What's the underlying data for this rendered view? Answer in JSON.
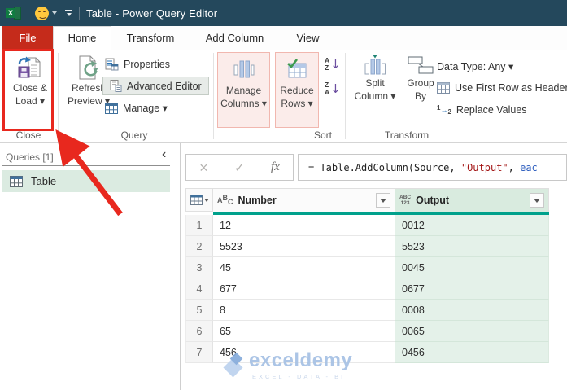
{
  "colors": {
    "titlebar": "#24485C",
    "file_tab_red": "#C52B1B",
    "accent_teal": "#00A18C",
    "selection_green": "#E4F1E9",
    "annotation_red": "#E8281E",
    "pink_highlight": "#FBECEA"
  },
  "titlebar": {
    "title": "Table - Power Query Editor",
    "excel_logo_letter": "X"
  },
  "tabs": {
    "file": "File",
    "home": "Home",
    "transform": "Transform",
    "add_column": "Add Column",
    "view": "View"
  },
  "ribbon": {
    "close_load": {
      "line1": "Close &",
      "line2": "Load ▾"
    },
    "refresh": {
      "line1": "Refresh",
      "line2": "Preview ▾"
    },
    "properties": "Properties",
    "advanced_editor": "Advanced Editor",
    "manage": "Manage ▾",
    "manage_columns": {
      "line1": "Manage",
      "line2": "Columns ▾"
    },
    "reduce_rows": {
      "line1": "Reduce",
      "line2": "Rows ▾"
    },
    "sort_az": {
      "top": "A",
      "bottom": "Z",
      "arrow": "↓"
    },
    "sort_za": {
      "top": "Z",
      "bottom": "A",
      "arrow": "↓"
    },
    "split_column": {
      "line1": "Split",
      "line2": "Column ▾"
    },
    "group_by": {
      "line1": "Group",
      "line2": "By"
    },
    "data_type": "Data Type: Any ▾",
    "use_first_row": "Use First Row as Header",
    "replace_values": "Replace Values",
    "replace_icon": {
      "from": "1",
      "to": "2"
    },
    "groups": {
      "close": "Close",
      "query": "Query",
      "sort": "Sort",
      "transform": "Transform"
    }
  },
  "queries_pane": {
    "header": "Queries [1]",
    "collapse_glyph": "‹",
    "items": [
      {
        "label": "Table"
      }
    ]
  },
  "formula_bar": {
    "cancel": "×",
    "check": "✓",
    "fx": "fx",
    "formula": {
      "prefix": "= Table.AddColumn(Source, ",
      "string": "\"Output\"",
      "separator": ", ",
      "keyword": "eac"
    }
  },
  "table": {
    "type_icons": {
      "abc": [
        "A",
        "B",
        "C"
      ],
      "abc123": [
        "ABC",
        "123"
      ]
    },
    "columns": [
      {
        "label": "Number",
        "type": "ABC",
        "selected": false
      },
      {
        "label": "Output",
        "type": "ABC 123",
        "selected": true
      }
    ],
    "rows": [
      {
        "num": "1",
        "number": "12",
        "output": "0012"
      },
      {
        "num": "2",
        "number": "5523",
        "output": "5523"
      },
      {
        "num": "3",
        "number": "45",
        "output": "0045"
      },
      {
        "num": "4",
        "number": "677",
        "output": "0677"
      },
      {
        "num": "5",
        "number": "8",
        "output": "0008"
      },
      {
        "num": "6",
        "number": "65",
        "output": "0065"
      },
      {
        "num": "7",
        "number": "456",
        "output": "0456"
      }
    ]
  },
  "watermark": {
    "brand": "exceldemy",
    "tagline": "EXCEL - DATA - BI"
  }
}
